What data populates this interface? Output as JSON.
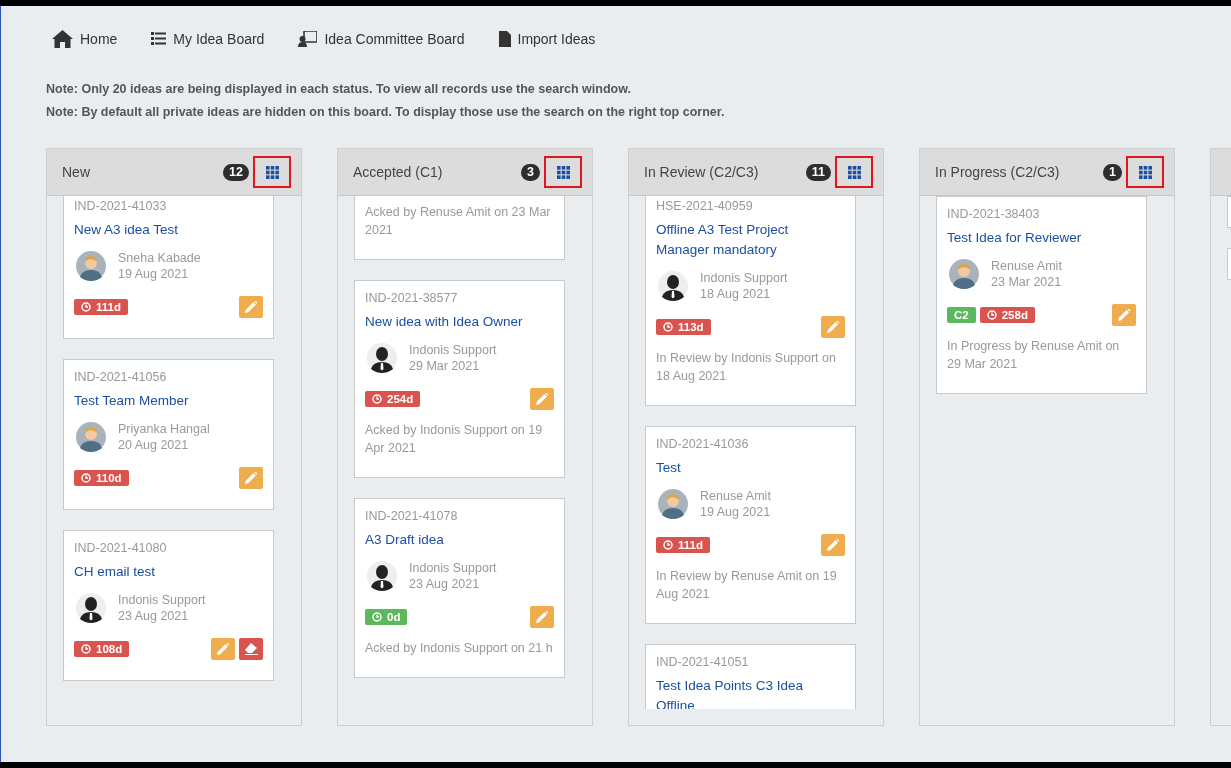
{
  "nav": [
    {
      "label": "Home"
    },
    {
      "label": "My Idea Board"
    },
    {
      "label": "Idea Committee Board"
    },
    {
      "label": "Import Ideas"
    }
  ],
  "notes": [
    "Note: Only 20 ideas are being displayed in each status. To view all records use the search window.",
    "Note: By default all private ideas are hidden on this board. To display those use the search on the right top corner."
  ],
  "columns": [
    {
      "title": "New",
      "count": "12",
      "cards": [
        {
          "clipped_top": true,
          "id": "IND-2021-41033",
          "title": "New A3 idea Test",
          "owner": "Sneha Kabade",
          "avatar": {
            "kind": "light"
          },
          "date": "19 Aug 2021",
          "badges": [
            {
              "kind": "age",
              "text": "111d",
              "color": "#d9534f"
            }
          ],
          "actions": [
            {
              "kind": "edit"
            }
          ]
        },
        {
          "clipped_top": false,
          "id": "IND-2021-41056",
          "title": "Test Team Member",
          "owner": "Priyanka Hangal",
          "avatar": {
            "kind": "light"
          },
          "date": "20 Aug 2021",
          "badges": [
            {
              "kind": "age",
              "text": "110d",
              "color": "#d9534f"
            }
          ],
          "actions": [
            {
              "kind": "edit"
            }
          ]
        },
        {
          "clipped_top": false,
          "id": "IND-2021-41080",
          "title": "CH email test",
          "owner": "Indonis Support",
          "avatar": {
            "kind": "dark"
          },
          "date": "23 Aug 2021",
          "badges": [
            {
              "kind": "age",
              "text": "108d",
              "color": "#d9534f"
            }
          ],
          "actions": [
            {
              "kind": "edit"
            },
            {
              "kind": "erase"
            }
          ]
        }
      ]
    },
    {
      "title": "Accepted (C1)",
      "count": "3",
      "cards": [
        {
          "clipped_top": true,
          "note": "Acked by Renuse Amit on 23 Mar 2021"
        },
        {
          "clipped_top": false,
          "id": "IND-2021-38577",
          "title": "New idea with Idea Owner",
          "owner": "Indonis Support",
          "avatar": {
            "kind": "dark"
          },
          "date": "29 Mar 2021",
          "badges": [
            {
              "kind": "age",
              "text": "254d",
              "color": "#d9534f"
            }
          ],
          "actions": [
            {
              "kind": "edit"
            }
          ],
          "note": "Acked by Indonis Support on 19 Apr 2021"
        },
        {
          "clipped_top": false,
          "id": "IND-2021-41078",
          "title": "A3 Draft idea",
          "owner": "Indonis Support",
          "avatar": {
            "kind": "dark"
          },
          "date": "23 Aug 2021",
          "badges": [
            {
              "kind": "age",
              "text": "0d",
              "color": "#5cb85c"
            }
          ],
          "actions": [
            {
              "kind": "edit"
            }
          ],
          "note": "Acked by Indonis Support on 21 h"
        }
      ]
    },
    {
      "title": "In Review (C2/C3)",
      "count": "11",
      "cards": [
        {
          "clipped_top": true,
          "id": "HSE-2021-40959",
          "title": "Offline A3 Test Project Manager mandatory",
          "owner": "Indonis Support",
          "avatar": {
            "kind": "dark"
          },
          "date": "18 Aug 2021",
          "badges": [
            {
              "kind": "age",
              "text": "113d",
              "color": "#d9534f"
            }
          ],
          "actions": [
            {
              "kind": "edit"
            }
          ],
          "note": "In Review by Indonis Support on 18 Aug 2021"
        },
        {
          "clipped_top": false,
          "id": "IND-2021-41036",
          "title": "Test",
          "owner": "Renuse Amit",
          "avatar": {
            "kind": "light"
          },
          "date": "19 Aug 2021",
          "badges": [
            {
              "kind": "age",
              "text": "111d",
              "color": "#d9534f"
            }
          ],
          "actions": [
            {
              "kind": "edit"
            }
          ],
          "note": "In Review by Renuse Amit on 19 Aug 2021"
        },
        {
          "clipped_top": false,
          "id": "IND-2021-41051",
          "title": "Test Idea Points C3 Idea Offline"
        }
      ]
    },
    {
      "title": "In Progress (C2/C3)",
      "count": "1",
      "cards": [
        {
          "clipped_top": false,
          "id": "IND-2021-38403",
          "title": "Test Idea for Reviewer",
          "owner": "Renuse Amit",
          "avatar": {
            "kind": "light"
          },
          "date": "23 Mar 2021",
          "badges": [
            {
              "kind": "stage",
              "text": "C2",
              "color": "#5cb85c"
            },
            {
              "kind": "age",
              "text": "258d",
              "color": "#d9534f"
            }
          ],
          "actions": [
            {
              "kind": "edit"
            }
          ],
          "note": "In Progress by Renuse Amit on 29 Mar 2021"
        }
      ]
    },
    {
      "cards": [
        {
          "clipped_top": false
        },
        {
          "clipped_top": false
        }
      ]
    }
  ]
}
